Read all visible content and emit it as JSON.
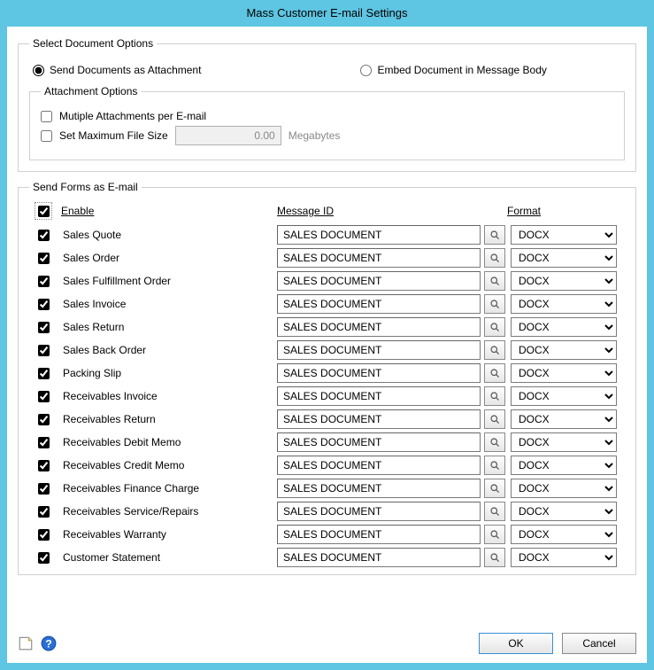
{
  "window": {
    "title": "Mass Customer E-mail Settings"
  },
  "docOptions": {
    "legend": "Select Document Options",
    "sendAttachment": "Send Documents as Attachment",
    "embedBody": "Embed Document in Message Body",
    "attachmentLegend": "Attachment Options",
    "multiple": "Mutiple Attachments per E-mail",
    "maxSize": "Set Maximum File Size",
    "maxSizeValue": "0.00",
    "megabytes": "Megabytes"
  },
  "forms": {
    "legend": "Send Forms as E-mail",
    "headers": {
      "enable": "Enable",
      "messageId": "Message ID",
      "format": "Format"
    },
    "defaultMessageId": "SALES DOCUMENT",
    "defaultFormat": "DOCX",
    "rows": [
      {
        "label": "Sales Quote"
      },
      {
        "label": "Sales Order"
      },
      {
        "label": "Sales Fulfillment Order"
      },
      {
        "label": "Sales Invoice"
      },
      {
        "label": "Sales Return"
      },
      {
        "label": "Sales Back Order"
      },
      {
        "label": "Packing Slip"
      },
      {
        "label": "Receivables Invoice"
      },
      {
        "label": "Receivables Return"
      },
      {
        "label": "Receivables Debit Memo"
      },
      {
        "label": "Receivables Credit Memo"
      },
      {
        "label": "Receivables Finance Charge"
      },
      {
        "label": "Receivables Service/Repairs"
      },
      {
        "label": "Receivables Warranty"
      },
      {
        "label": "Customer Statement"
      }
    ]
  },
  "footer": {
    "ok": "OK",
    "cancel": "Cancel"
  }
}
